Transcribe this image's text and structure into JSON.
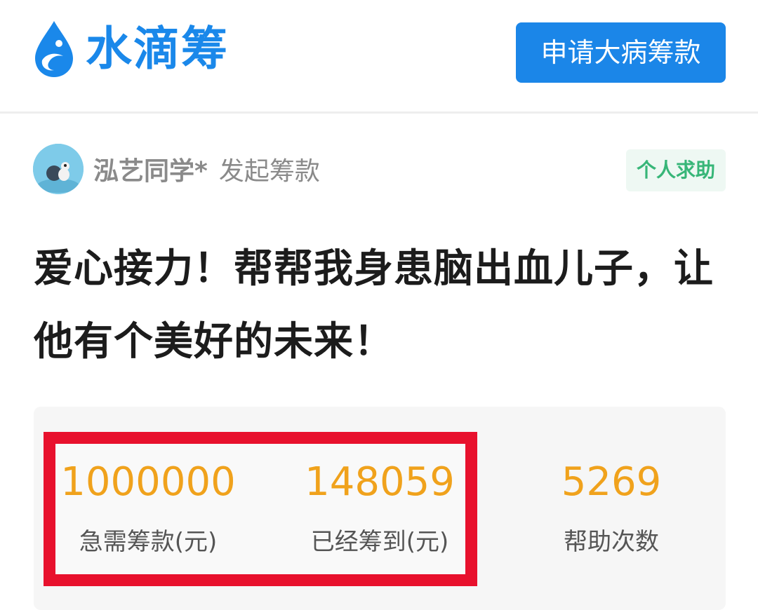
{
  "header": {
    "logo_text": "水滴筹",
    "logo_icon": "water-drop-icon",
    "apply_button_label": "申请大病筹款",
    "brand_color": "#1b86e8"
  },
  "launcher": {
    "name": "泓艺同学*",
    "action": "发起筹款",
    "tag": "个人求助"
  },
  "campaign": {
    "title": "爱心接力！帮帮我身患脑出血儿子，让他有个美好的未来！"
  },
  "stats": [
    {
      "value": "1000000",
      "label": "急需筹款(元)"
    },
    {
      "value": "148059",
      "label": "已经筹到(元)"
    },
    {
      "value": "5269",
      "label": "帮助次数"
    }
  ],
  "colors": {
    "stat_value": "#f0a21c",
    "highlight_border": "#e8112d",
    "tag_text": "#37b678"
  }
}
